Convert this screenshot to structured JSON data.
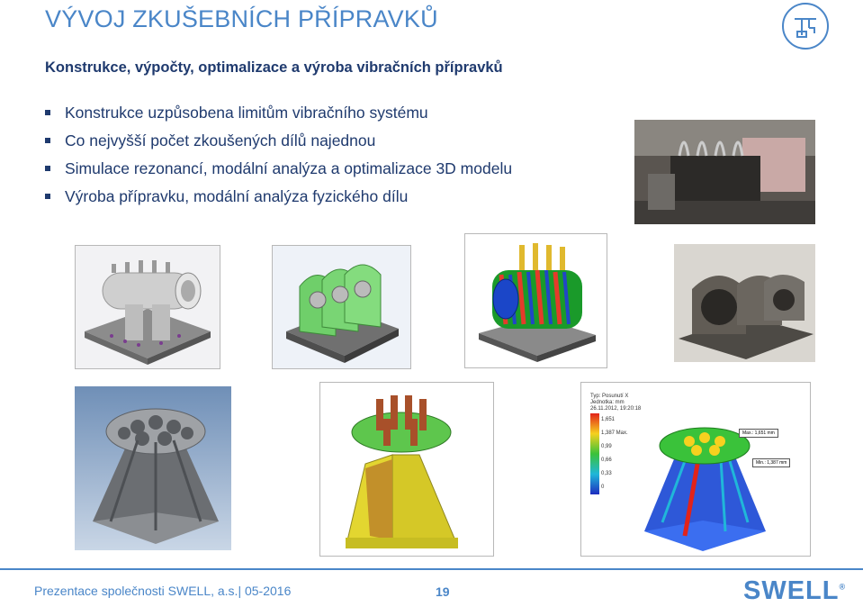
{
  "title": "VÝVOJ ZKUŠEBNÍCH PŘÍPRAVKŮ",
  "subtitle": "Konstrukce, výpočty, optimalizace a výroba vibračních přípravků",
  "bullets": [
    "Konstrukce uzpůsobena limitům vibračního systému",
    "Co nejvyšší počet zkoušených dílů najednou",
    "Simulace rezonancí, modální analýza a optimalizace 3D modelu",
    "Výroba přípravku, modální analýza fyzického dílu"
  ],
  "fea_legend": {
    "type": "Typ: Posunutí X",
    "unit": "Jednotka: mm",
    "date": "26.11.2012, 19:20:18",
    "values": [
      "1,651",
      "1,387 Max.",
      "0,99",
      "0,66",
      "0,33",
      "0"
    ],
    "callout_top": "Max.: 1,651 mm",
    "callout_bottom": "Min.: 1,387 mm"
  },
  "footer": {
    "text": "Prezentace společnosti SWELL, a.s.| 05-2016",
    "page": "19",
    "brand": "SWELL",
    "brand_mark": "®"
  },
  "colors": {
    "title": "#4a86c8",
    "text": "#1f3a6e",
    "footer": "#4a86c8"
  }
}
